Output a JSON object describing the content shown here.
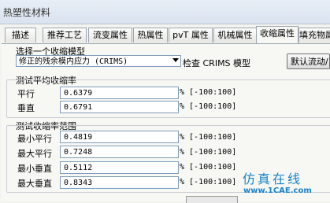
{
  "window": {
    "title": "热塑性材料"
  },
  "tabs": [
    "描述",
    "推荐工艺",
    "流变属性",
    "热属性",
    "pvT 属性",
    "机械属性",
    "收缩属性",
    "填充物属"
  ],
  "active_tab": "收缩属性",
  "model_section": {
    "label": "选择一个收缩模型",
    "selected_model": "修正的残余模内应力 (CRIMS)",
    "check_button": "检查 CRIMS 模型",
    "default_button": "默认流动/"
  },
  "average_section": {
    "label": "测试平均收缩率",
    "rows": [
      {
        "label": "平行",
        "value": "0.6379",
        "range": "% [-100:100]"
      },
      {
        "label": "垂直",
        "value": "0.6791",
        "range": "% [-100:100]"
      }
    ]
  },
  "range_section": {
    "label": "测试收缩率范围",
    "rows": [
      {
        "label": "最小平行",
        "value": "0.4819",
        "range": "% [-100:100]"
      },
      {
        "label": "最大平行",
        "value": "0.7248",
        "range": "% [-100:100]"
      },
      {
        "label": "最小垂直",
        "value": "0.5112",
        "range": "% [-100:100]"
      },
      {
        "label": "最大垂直",
        "value": "0.8343",
        "range": "% [-100:100]"
      }
    ]
  },
  "watermark": {
    "text": "仿真在线",
    "url": "www.1CAE.com"
  }
}
